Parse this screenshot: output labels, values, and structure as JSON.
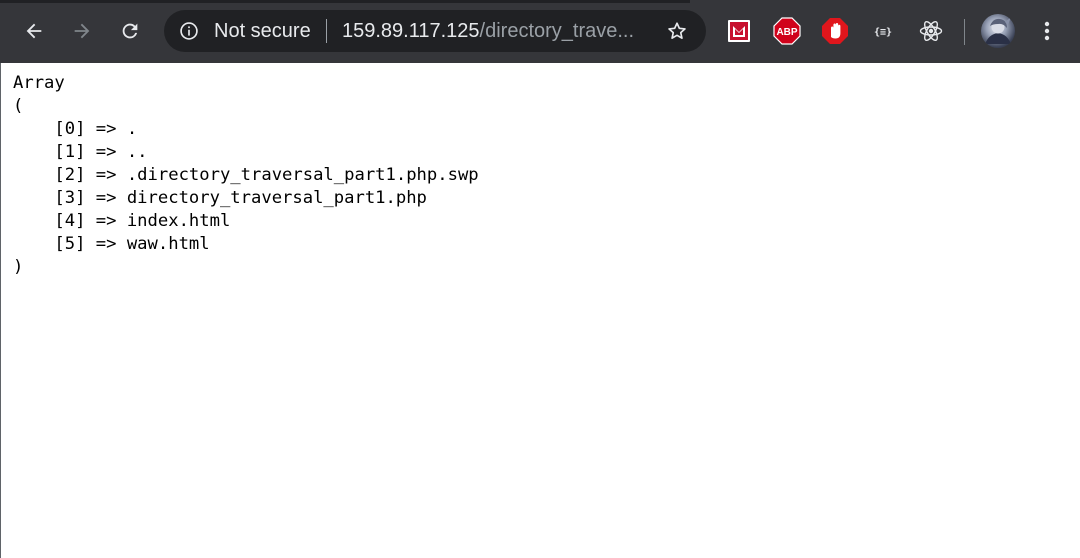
{
  "browser": {
    "security_label": "Not secure",
    "url_host": "159.89.117.125",
    "url_path": "/directory_trave...",
    "icons": {
      "back": "back-arrow-icon",
      "forward": "forward-arrow-icon",
      "reload": "reload-icon",
      "info": "info-icon",
      "bookmark": "star-icon",
      "menu": "kebab-menu-icon"
    },
    "extensions": [
      {
        "name": "mcafee-extension-icon",
        "color": "#c8102e"
      },
      {
        "name": "adblock-plus-icon",
        "text": "ABP",
        "color": "#d0021b"
      },
      {
        "name": "adblock-hand-icon",
        "color": "#e0161c"
      },
      {
        "name": "json-formatter-icon",
        "text": "{≡}"
      },
      {
        "name": "react-devtools-icon",
        "color": "#e8eaed"
      }
    ]
  },
  "page": {
    "lines": [
      "Array",
      "(",
      "    [0] => .",
      "    [1] => ..",
      "    [2] => .directory_traversal_part1.php.swp",
      "    [3] => directory_traversal_part1.php",
      "    [4] => index.html",
      "    [5] => waw.html",
      ")"
    ]
  },
  "colors": {
    "toolbar": "#35363a",
    "omnibox": "#202124",
    "text_light": "#e8eaed",
    "text_dim": "#9aa0a6",
    "page_bg": "#ffffff",
    "page_text": "#000000"
  }
}
